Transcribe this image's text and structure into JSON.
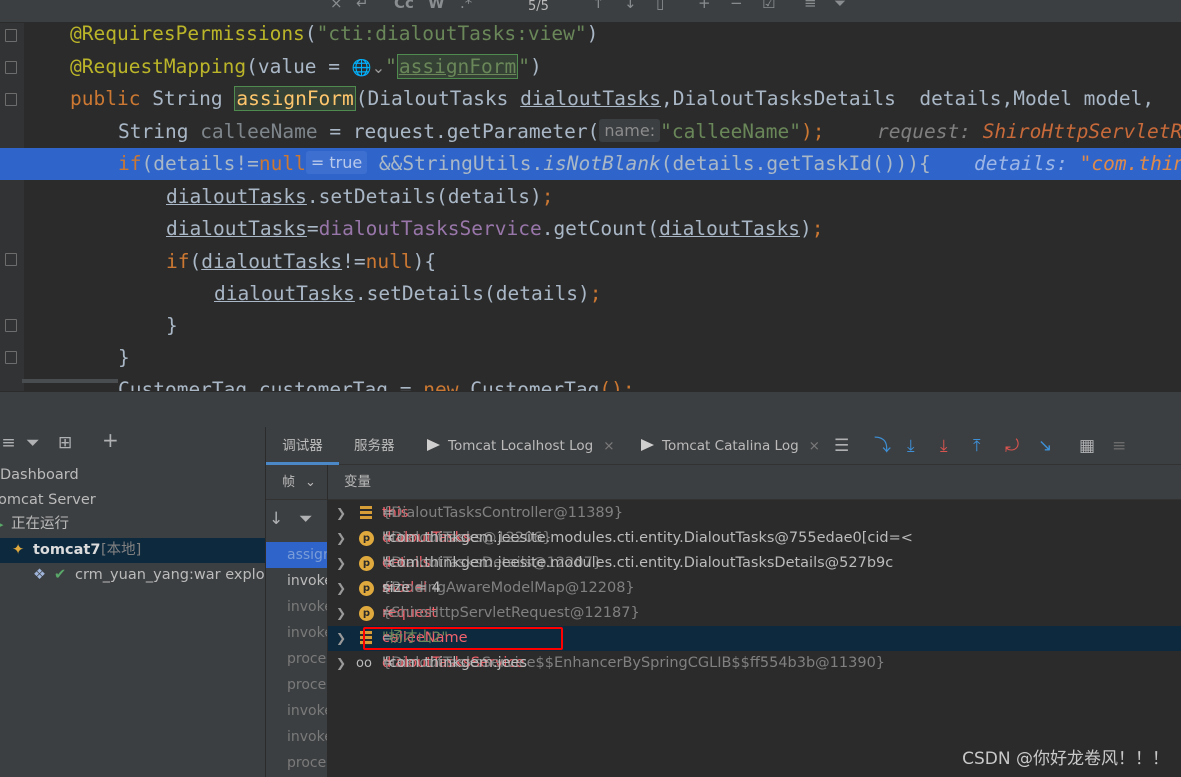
{
  "find_bar": {
    "match_count": "5/5",
    "case_label": "Cc",
    "word_label": "W"
  },
  "editor": {
    "l1": {
      "annotation": "@RequiresPermissions",
      "open": "(",
      "string": "\"cti:dialoutTasks:view\"",
      "close": ")"
    },
    "l2": {
      "annotation": "@RequestMapping",
      "open": "(value = ",
      "globe": "🌐⌄",
      "q1": "\"",
      "mapping": "assignForm",
      "q2": "\"",
      "close": ")"
    },
    "l3": {
      "public": "public ",
      "type": "String ",
      "method": "assignForm",
      "p1": "(DialoutTasks ",
      "p1name": "dialoutTasks",
      "p2": ",DialoutTasksDetails  details,Model model, "
    },
    "l4": {
      "type": "String ",
      "var": "calleeName",
      "assign": " = request.getParameter(",
      "hint": "name:",
      "arg": "\"calleeName\"",
      "end": ");",
      "dbg_label": "request: ",
      "dbg_value": "ShiroHttpServletR"
    },
    "l5": {
      "if": "if",
      "cond": "(details!=",
      "null": "null",
      "pill": "= true",
      "and": " &&StringUtils.",
      "call": "isNotBlank",
      "rest": "(details.getTaskId())){",
      "dbg_label": "details: ",
      "dbg_value": "\"com.thin"
    },
    "l6": {
      "obj": "dialoutTasks",
      "call": ".setDetails(details)",
      "semi": ";"
    },
    "l7": {
      "lhs": "dialoutTasks",
      "eq": "=",
      "svc": "dialoutTasksService",
      "call": ".getCount(",
      "arg": "dialoutTasks",
      "close": ")",
      "semi": ";"
    },
    "l8": {
      "if": "if",
      "open": "(",
      "var": "dialoutTasks",
      "neq": "!=",
      "null": "null",
      "close": "){"
    },
    "l9": {
      "obj": "dialoutTasks",
      "call": ".setDetails(details)",
      "semi": ";"
    },
    "l10": {
      "brace": "}"
    },
    "l11": {
      "brace": "}"
    },
    "l12": {
      "type": "CustomerTag ",
      "var": "customerTag",
      "eq": " = ",
      "new": "new ",
      "ctor": "CustomerTag",
      "end": "();"
    }
  },
  "services": {
    "toolbar": [
      "⁝≡",
      "⏷",
      "⊞",
      "+"
    ],
    "tree": [
      {
        "label": "Dashboard"
      },
      {
        "label": "omcat Server"
      },
      {
        "label": "正在运行"
      },
      {
        "label": "tomcat7",
        "tag": "[本地]"
      },
      {
        "label": "crm_yuan_yang:war exploded"
      }
    ]
  },
  "debugger": {
    "tabs": [
      {
        "label": "调试器"
      },
      {
        "label": "服务器"
      },
      {
        "label": "Tomcat Localhost Log",
        "close": "×"
      },
      {
        "label": "Tomcat Catalina Log",
        "close": "×"
      }
    ],
    "frames_header": "帧",
    "frames": [
      "assignForm",
      "invoke",
      "invoke",
      "invoke",
      "process",
      "process",
      "invoke",
      "invoke",
      "process"
    ],
    "vars_header": "变量",
    "variables": [
      {
        "name": "this",
        "eq": " = ",
        "type": "{DialoutTasksController@11389}",
        "value": ""
      },
      {
        "name": "dialoutTasks",
        "eq": " = ",
        "type": "{DialoutTasks@12206}",
        "value": " \"com.thinkgem.jeesite.modules.cti.entity.DialoutTasks@755edae0[cid=<"
      },
      {
        "name": "details",
        "eq": " = ",
        "type": "{DialoutTasksDetails@12207}",
        "value": " \"com.thinkgem.jeesite.modules.cti.entity.DialoutTasksDetails@527b9c"
      },
      {
        "name": "model",
        "eq": " = ",
        "type": "{BindingAwareModelMap@12208}",
        "value": "  size = 4"
      },
      {
        "name": "request",
        "eq": " = ",
        "type": "{ShiroHttpServletRequest@12187}",
        "value": ""
      },
      {
        "name": "calleeName",
        "eq": " = ",
        "type": "",
        "value": "\"杨才山2\""
      },
      {
        "name": "dialoutTasksService",
        "eq": " = ",
        "type": "{DialoutTasksService$$EnhancerBySpringCGLIB$$ff554b3b@11390}",
        "value": " \"com.thinkgem.jees"
      }
    ]
  },
  "watermark": "CSDN @你好龙卷风！！！"
}
